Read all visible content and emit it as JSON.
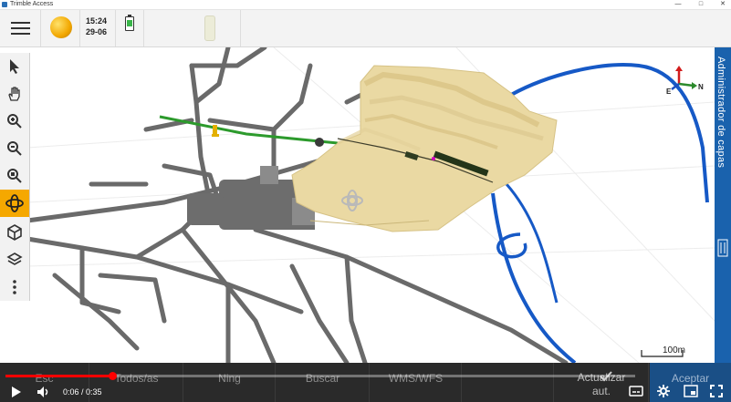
{
  "window": {
    "title": "Trimble Access",
    "controls": [
      "—",
      "□",
      "✕"
    ]
  },
  "status": {
    "time": "15:24",
    "date": "29-06"
  },
  "toolbar": {
    "items": [
      {
        "name": "select",
        "icon": "pointer-icon"
      },
      {
        "name": "pan",
        "icon": "hand-icon"
      },
      {
        "name": "zoom-in",
        "icon": "zoom-in-icon"
      },
      {
        "name": "zoom-out",
        "icon": "zoom-out-icon"
      },
      {
        "name": "zoom-extents",
        "icon": "zoom-extents-icon"
      },
      {
        "name": "orbit",
        "icon": "orbit-icon",
        "active": true
      },
      {
        "name": "view-3d",
        "icon": "cube-icon"
      },
      {
        "name": "layers",
        "icon": "layers-icon"
      },
      {
        "name": "more",
        "icon": "more-vertical-icon"
      }
    ]
  },
  "layer_panel": {
    "label": "Administrador de capas"
  },
  "compass": {
    "north": "N",
    "east": "E"
  },
  "scale": {
    "label": "100m"
  },
  "softkeys": {
    "esc": "Esc",
    "all": "Todos/as",
    "none": "Ning",
    "search": "Buscar",
    "wms": "WMS/WFS",
    "auto_update_line1": "Actualizar",
    "auto_update_line2": "aut.",
    "accept": "Aceptar"
  },
  "video": {
    "time": "0:06 / 0:35",
    "progress": 0.17
  },
  "colors": {
    "accent_orange": "#f5a800",
    "panel_blue": "#1a62ad",
    "road_gray": "#6a6a6a",
    "alignment_blue": "#1659c6",
    "surface_sand": "#ead9a3",
    "green_line": "#2c9a2c"
  }
}
